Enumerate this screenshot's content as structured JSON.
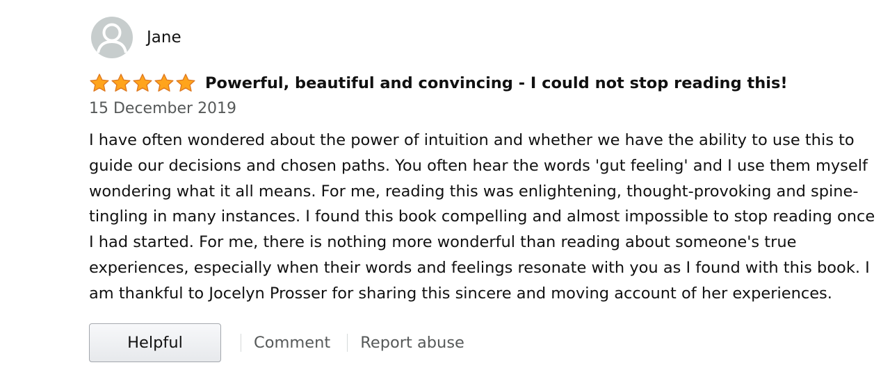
{
  "review": {
    "author": "Jane",
    "rating": 5,
    "rating_max": 5,
    "title": "Powerful, beautiful and convincing - I could not stop reading this!",
    "date": "15 December 2019",
    "body": "I have often wondered about the power of intuition and whether we have the ability to use this to guide our decisions and chosen paths. You often hear the words 'gut feeling' and I use them myself wondering what it all means. For me, reading this was enlightening, thought-provoking and spine-tingling in many instances. I found this book compelling and almost impossible to stop reading once I had started. For me, there is nothing more wonderful than reading about someone's true experiences, especially when their words and feelings resonate with you as I found with this book. I am thankful to Jocelyn Prosser for sharing this sincere and moving account of her experiences."
  },
  "actions": {
    "helpful_label": "Helpful",
    "comment_label": "Comment",
    "report_label": "Report abuse"
  },
  "icons": {
    "avatar": "default-user-avatar-icon",
    "star": "star-icon"
  },
  "colors": {
    "star_fill": "#ffa41c",
    "star_stroke": "#de7921",
    "secondary_text": "#565959",
    "avatar_bg": "#c7cdcd"
  }
}
